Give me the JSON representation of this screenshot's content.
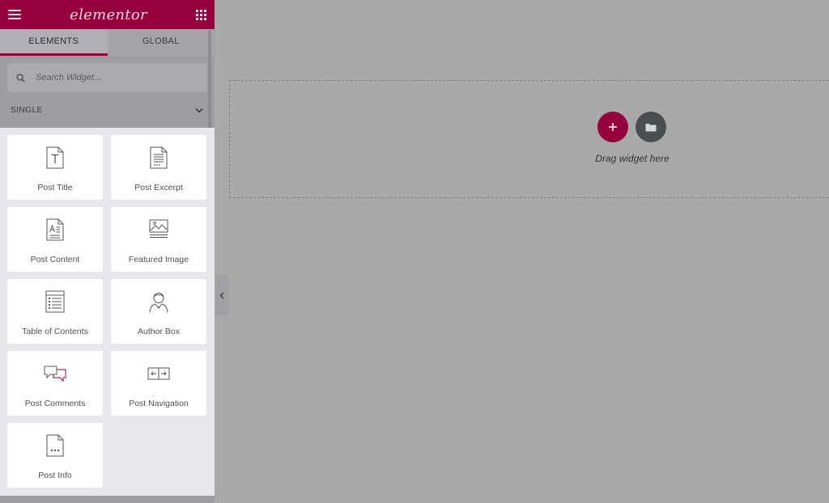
{
  "header": {
    "logo": "elementor"
  },
  "tabs": [
    {
      "label": "ELEMENTS",
      "active": true
    },
    {
      "label": "GLOBAL",
      "active": false
    }
  ],
  "search": {
    "placeholder": "Search Widget...",
    "value": ""
  },
  "category": {
    "label": "SINGLE",
    "icon": "chevron-down-icon"
  },
  "widgets": [
    {
      "label": "Post Title",
      "icon": "post-title-icon"
    },
    {
      "label": "Post Excerpt",
      "icon": "post-excerpt-icon"
    },
    {
      "label": "Post Content",
      "icon": "post-content-icon"
    },
    {
      "label": "Featured Image",
      "icon": "featured-image-icon"
    },
    {
      "label": "Table of Contents",
      "icon": "table-of-contents-icon"
    },
    {
      "label": "Author Box",
      "icon": "author-box-icon"
    },
    {
      "label": "Post Comments",
      "icon": "post-comments-icon"
    },
    {
      "label": "Post Navigation",
      "icon": "post-navigation-icon"
    },
    {
      "label": "Post Info",
      "icon": "post-info-icon"
    }
  ],
  "canvas": {
    "drag_text": "Drag widget here"
  },
  "colors": {
    "brand": "#93003c",
    "dark_button": "#4a4d52",
    "widget_bg": "#ffffff",
    "panel_bg": "#e6e8eb"
  }
}
